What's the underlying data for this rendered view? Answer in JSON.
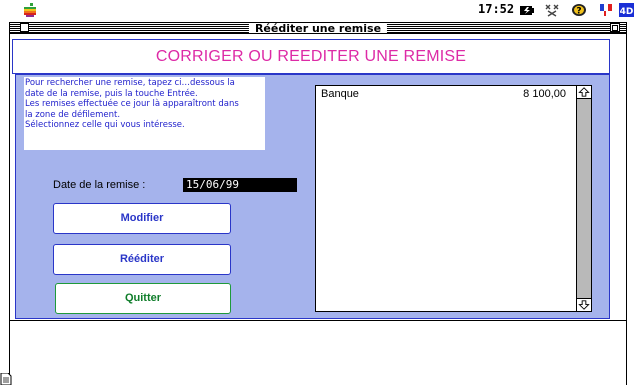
{
  "menubar": {
    "time": "17:52",
    "icons": [
      "apple-icon",
      "battery-icon",
      "network-icon",
      "help-icon",
      "flag-icon",
      "4d-app-icon"
    ],
    "app_badge": "4D"
  },
  "window": {
    "title": "Rééditer une remise"
  },
  "header": {
    "title": "CORRIGER OU REEDITER UNE REMISE",
    "title_color": "#dd2aa6"
  },
  "instructions": {
    "text": "Pour rechercher une remise, tapez ci…dessous la\ndate de la remise, puis la touche Entrée.\nLes remises effectuée ce jour là apparaîtront dans\nla zone de défilement.\nSélectionnez celle qui vous intéresse."
  },
  "date_field": {
    "label": "Date de la remise :",
    "value": "15/06/99"
  },
  "buttons": {
    "modify": "Modifier",
    "reissue": "Rééditer",
    "quit": "Quitter"
  },
  "list": {
    "items": [
      {
        "name": "Banque",
        "amount": "8 100,00"
      }
    ]
  },
  "colors": {
    "panel_bg": "#a5b3ec",
    "border_blue": "#2a36c8",
    "quit_green": "#1f9a3a",
    "instr_text": "#2222cc"
  }
}
